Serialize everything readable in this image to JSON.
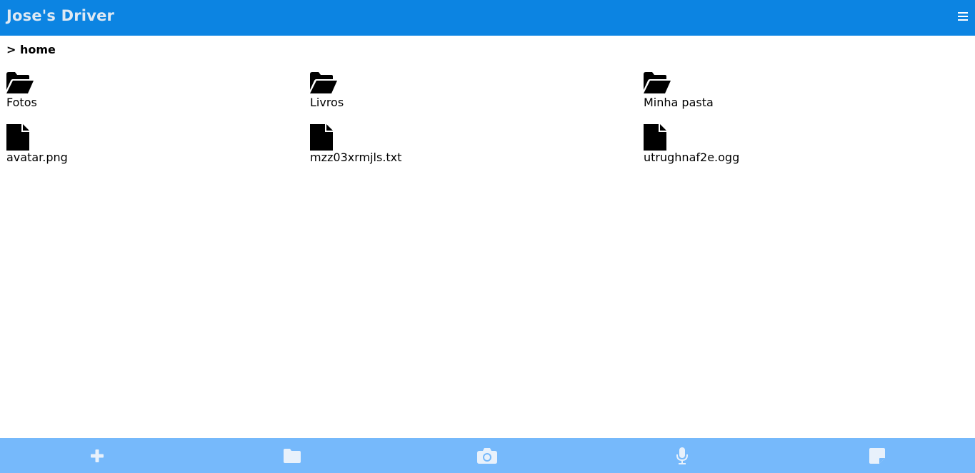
{
  "app": {
    "title": "Jose's Driver",
    "menu_icon": "hamburger-menu-icon"
  },
  "breadcrumb": {
    "text": "> home"
  },
  "folders": [
    {
      "name": "Fotos",
      "icon": "folder-open-icon"
    },
    {
      "name": "Livros",
      "icon": "folder-open-icon"
    },
    {
      "name": "Minha pasta",
      "icon": "folder-open-icon"
    }
  ],
  "files": [
    {
      "name": "avatar.png",
      "icon": "file-icon"
    },
    {
      "name": "mzz03xrmjls.txt",
      "icon": "file-icon"
    },
    {
      "name": "utrughnaf2e.ogg",
      "icon": "file-icon"
    }
  ],
  "toolbar": {
    "buttons": [
      {
        "icon": "plus-icon"
      },
      {
        "icon": "folder-icon"
      },
      {
        "icon": "camera-icon"
      },
      {
        "icon": "microphone-icon"
      },
      {
        "icon": "note-icon"
      }
    ]
  },
  "colors": {
    "header_bg": "#0c84e2",
    "title_text": "#dfe9f3",
    "toolbar_bg": "#76b9fb",
    "toolbar_icon": "#e8f1fb"
  }
}
